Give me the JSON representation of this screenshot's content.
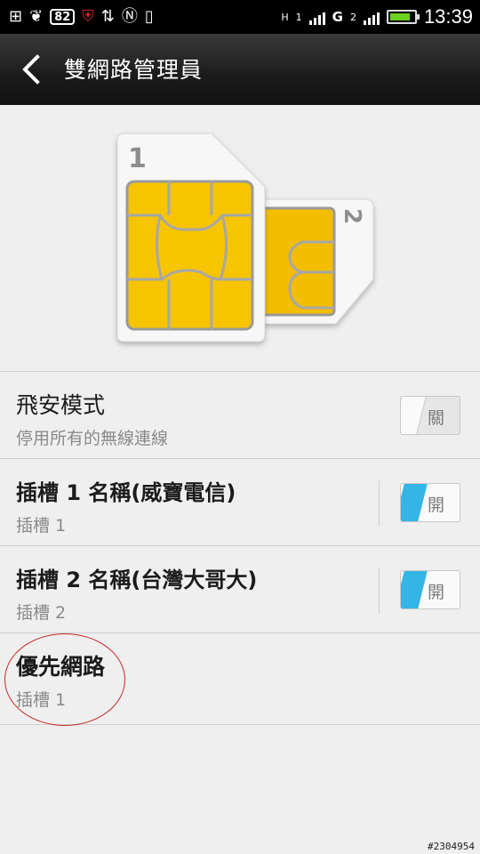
{
  "status_bar": {
    "notification_count": "82",
    "network_h": "H",
    "network_g": "G",
    "sim1_signal_label": "1",
    "sim2_signal_label": "2",
    "time": "13:39",
    "battery_level": 0.85
  },
  "header": {
    "title": "雙網路管理員"
  },
  "illustration": {
    "sim1_number": "1",
    "sim2_number": "2",
    "chip_color": "#f7c400"
  },
  "settings": [
    {
      "title": "飛安模式",
      "subtitle": "停用所有的無線連線",
      "toggle_state": "off",
      "toggle_label": "關"
    },
    {
      "title": "插槽 1 名稱(威寶電信)",
      "subtitle": "插槽 1",
      "toggle_state": "on",
      "toggle_label": "開"
    },
    {
      "title": "插槽 2 名稱(台灣大哥大)",
      "subtitle": "插槽 2",
      "toggle_state": "on",
      "toggle_label": "開"
    },
    {
      "title": "優先網路",
      "subtitle": "插槽 1"
    }
  ],
  "watermark": "#2304954",
  "colors": {
    "accent": "#33b5e5",
    "annotation": "#c62828",
    "chip": "#f7c400"
  }
}
